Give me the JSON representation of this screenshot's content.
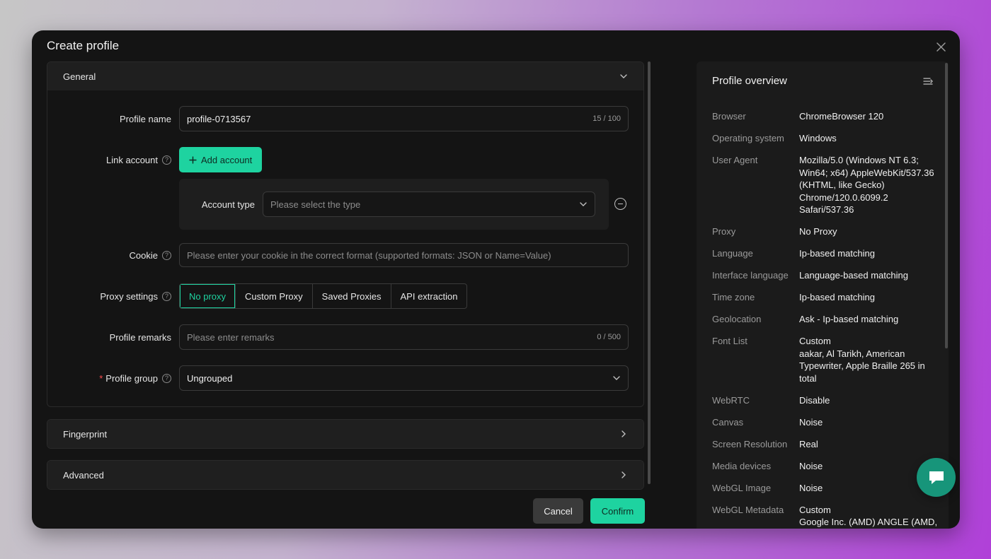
{
  "modal": {
    "title": "Create profile"
  },
  "general": {
    "title": "General",
    "profile_name": {
      "label": "Profile name",
      "value": "profile-0713567",
      "counter": "15 / 100"
    },
    "link_account": {
      "label": "Link account",
      "button": "Add account"
    },
    "account_type": {
      "label": "Account type",
      "placeholder": "Please select the type"
    },
    "cookie": {
      "label": "Cookie",
      "placeholder": "Please enter your cookie in the correct format (supported formats: JSON or Name=Value)"
    },
    "proxy": {
      "label": "Proxy settings",
      "options": [
        "No proxy",
        "Custom Proxy",
        "Saved Proxies",
        "API extraction"
      ],
      "selected": "No proxy"
    },
    "remarks": {
      "label": "Profile remarks",
      "placeholder": "Please enter remarks",
      "counter": "0 / 500"
    },
    "group": {
      "required_mark": "*",
      "label": "Profile group",
      "value": "Ungrouped"
    }
  },
  "fingerprint": {
    "title": "Fingerprint"
  },
  "advanced": {
    "title": "Advanced"
  },
  "footer": {
    "cancel": "Cancel",
    "confirm": "Confirm"
  },
  "overview": {
    "title": "Profile overview",
    "rows": [
      {
        "key": "Browser",
        "value": "ChromeBrowser 120"
      },
      {
        "key": "Operating system",
        "value": "Windows"
      },
      {
        "key": "User Agent",
        "value": "Mozilla/5.0 (Windows NT 6.3; Win64; x64) AppleWebKit/537.36 (KHTML, like Gecko) Chrome/120.0.6099.2 Safari/537.36"
      },
      {
        "key": "Proxy",
        "value": "No Proxy"
      },
      {
        "key": "Language",
        "value": "Ip-based matching"
      },
      {
        "key": "Interface language",
        "value": "Language-based matching"
      },
      {
        "key": "Time zone",
        "value": "Ip-based matching"
      },
      {
        "key": "Geolocation",
        "value": "Ask - Ip-based matching"
      },
      {
        "key": "Font List",
        "value": "Custom\naakar, Al Tarikh, American Typewriter, Apple Braille 265 in total"
      },
      {
        "key": "WebRTC",
        "value": "Disable"
      },
      {
        "key": "Canvas",
        "value": "Noise"
      },
      {
        "key": "Screen Resolution",
        "value": "Real"
      },
      {
        "key": "Media devices",
        "value": "Noise"
      },
      {
        "key": "WebGL Image",
        "value": "Noise"
      },
      {
        "key": "WebGL Metadata",
        "value": "Custom\nGoogle Inc. (AMD) ANGLE (AMD,"
      }
    ]
  },
  "colors": {
    "accent": "#1ed3a0",
    "modal_bg": "#141414",
    "chat_fab": "#17957a"
  }
}
